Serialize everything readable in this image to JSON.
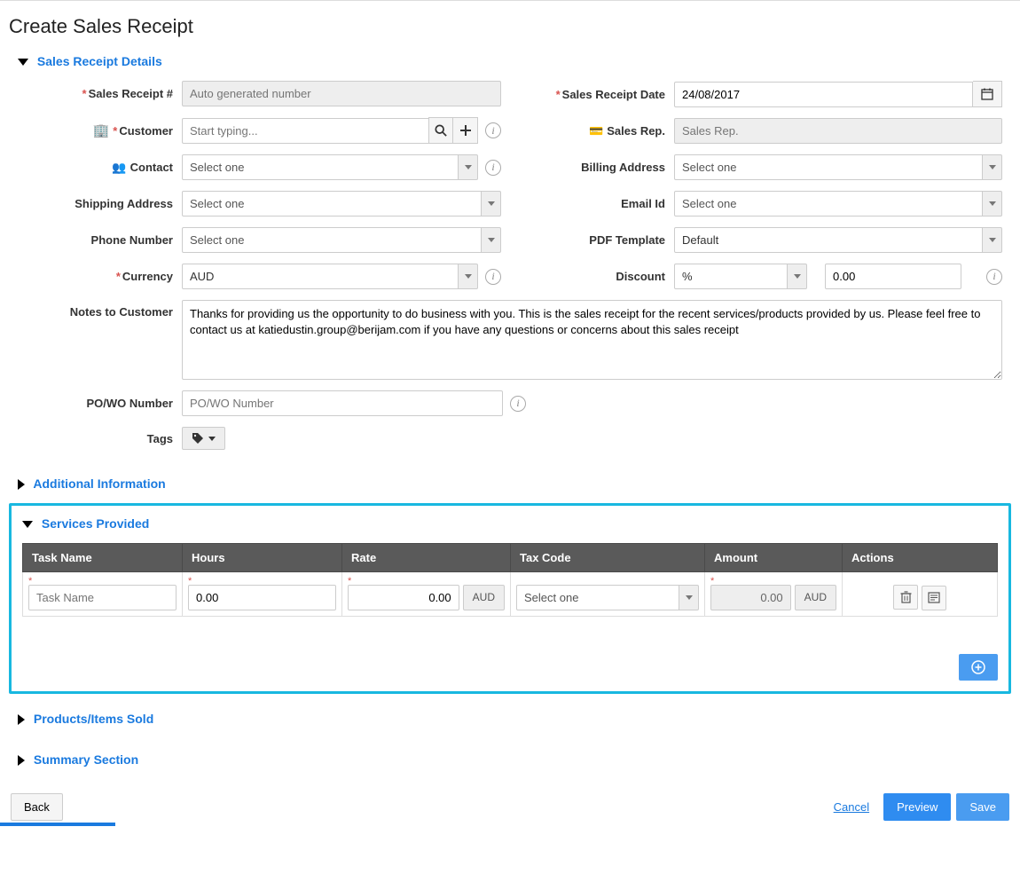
{
  "page": {
    "title": "Create Sales Receipt"
  },
  "sections": {
    "details": "Sales Receipt Details",
    "additional": "Additional Information",
    "services": "Services Provided",
    "products": "Products/Items Sold",
    "summary": "Summary Section"
  },
  "labels": {
    "receipt_no": "Sales Receipt #",
    "customer": "Customer",
    "contact": "Contact",
    "shipping": "Shipping Address",
    "phone": "Phone Number",
    "currency": "Currency",
    "notes": "Notes to Customer",
    "po": "PO/WO Number",
    "tags": "Tags",
    "date": "Sales Receipt Date",
    "salesrep": "Sales Rep.",
    "billing": "Billing Address",
    "email": "Email Id",
    "pdf": "PDF Template",
    "discount": "Discount"
  },
  "fields": {
    "receipt_no_placeholder": "Auto generated number",
    "customer_placeholder": "Start typing...",
    "select_one": "Select one",
    "currency_value": "AUD",
    "notes_value": "Thanks for providing us the opportunity to do business with you. This is the sales receipt for the recent services/products provided by us. Please feel free to contact us at katiedustin.group@berijam.com if you have any questions or concerns about this sales receipt",
    "po_placeholder": "PO/WO Number",
    "date_value": "24/08/2017",
    "salesrep_placeholder": "Sales Rep.",
    "pdf_value": "Default",
    "discount_type": "%",
    "discount_value": "0.00"
  },
  "services_table": {
    "headers": {
      "task": "Task Name",
      "hours": "Hours",
      "rate": "Rate",
      "tax": "Tax Code",
      "amount": "Amount",
      "actions": "Actions"
    },
    "row": {
      "task_placeholder": "Task Name",
      "hours_value": "0.00",
      "rate_value": "0.00",
      "rate_addon": "AUD",
      "tax_placeholder": "Select one",
      "amount_value": "0.00",
      "amount_addon": "AUD"
    }
  },
  "footer": {
    "back": "Back",
    "cancel": "Cancel",
    "preview": "Preview",
    "save": "Save"
  }
}
